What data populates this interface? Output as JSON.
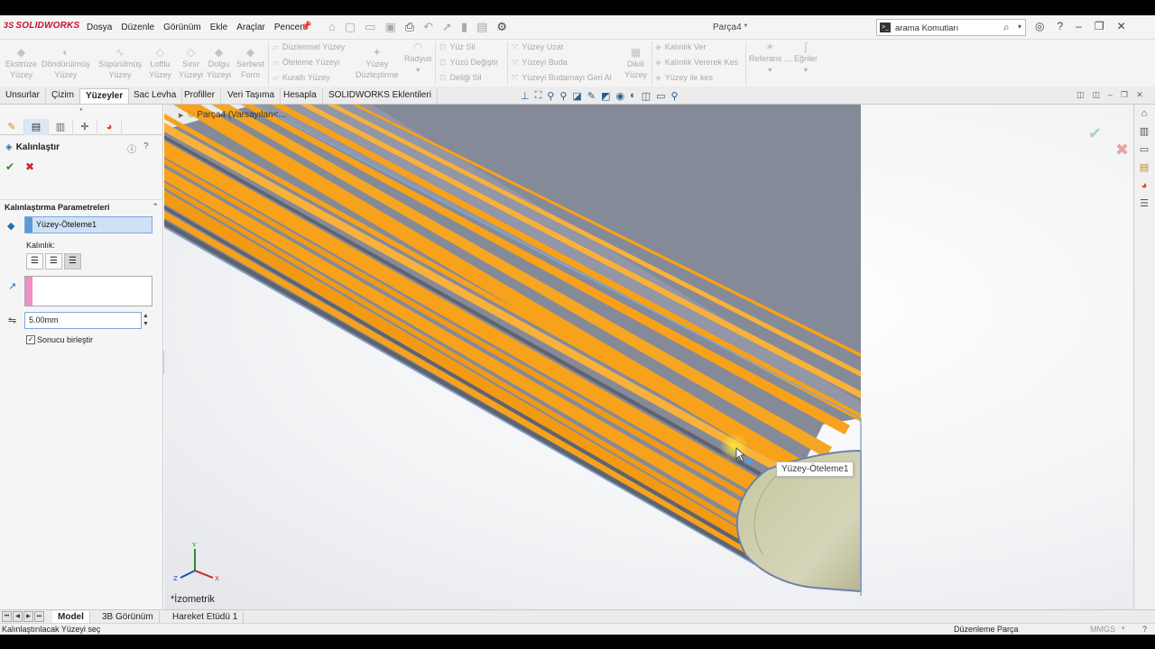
{
  "app": {
    "logo": "SOLIDWORKS",
    "logo_mark": "3S",
    "document_title": "Parça4 *"
  },
  "menu": [
    "Dosya",
    "Düzenle",
    "Görünüm",
    "Ekle",
    "Araçlar",
    "Pencere"
  ],
  "search": {
    "placeholder": "arama Komutları"
  },
  "commands": {
    "big": [
      {
        "l1": "Ekstrüze",
        "l2": "Yüzey"
      },
      {
        "l1": "Döndürülmüş",
        "l2": "Yüzey"
      },
      {
        "l1": "Süpürülmüş",
        "l2": "Yüzey"
      },
      {
        "l1": "Loftlu",
        "l2": "Yüzey"
      },
      {
        "l1": "Sınır",
        "l2": "Yüzeyi"
      },
      {
        "l1": "Dolgu",
        "l2": "Yüzeyi"
      },
      {
        "l1": "Serbest",
        "l2": "Form"
      }
    ],
    "col1": [
      "Düzlemsel Yüzey",
      "Öteleme Yüzeyi",
      "Kurallı Yüzey"
    ],
    "flatten": {
      "l1": "Yüzey",
      "l2": "Düzleştirme"
    },
    "fillet": "Radyus",
    "col2": [
      "Yüz Sil",
      "Yüzü Değiştir",
      "Deliği Sil"
    ],
    "col3": [
      "Yüzey Uzat",
      "Yüzeyi Buda",
      "Yüzeyi Budamayı Geri Al"
    ],
    "knit": {
      "l1": "Dikili",
      "l2": "Yüzey"
    },
    "col4": [
      "Kalınlık Ver",
      "Kalınlık Vererek Kes",
      "Yüzey ile kes"
    ],
    "ref": "Referans ...",
    "curves": "Eğriler"
  },
  "tabs": [
    "Unsurlar",
    "Çizim",
    "Yüzeyler",
    "Sac Levha",
    "Profiller",
    "Veri Taşıma",
    "Hesapla",
    "SOLIDWORKS Eklentileri"
  ],
  "property_manager": {
    "title": "Kalınlaştır",
    "group": "Kalınlaştırma Parametreleri",
    "selected_face": "Yüzey-Öteleme1",
    "thickness_label": "Kalınlık:",
    "thickness_value": "5.00mm",
    "merge_label": "Sonucu birleştir",
    "merge_checked": true
  },
  "viewport": {
    "tree_root": "Parça4  (Varsayılan<...",
    "tooltip": "Yüzey-Öteleme1",
    "view_name": "*İzometrik"
  },
  "bottom_tabs": [
    "Model",
    "3B Görünüm",
    "Hareket Etüdü 1"
  ],
  "status": {
    "left": "Kalınlaştırılacak Yüzeyi seç",
    "mode": "Düzenleme Parça",
    "units": "MMGS"
  },
  "colors": {
    "stripe_orange": "#f7a21a",
    "stripe_gray": "#7f8596",
    "face_fill": "#c9c8a3",
    "accent_blue": "#2a6cb0"
  }
}
